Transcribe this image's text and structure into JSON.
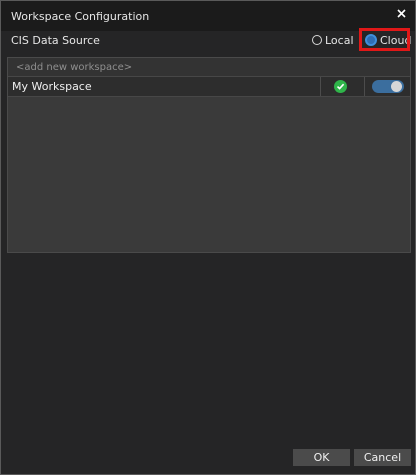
{
  "dialog": {
    "title": "Workspace Configuration"
  },
  "source": {
    "label": "CIS Data Source",
    "options": [
      {
        "label": "Local",
        "selected": false
      },
      {
        "label": "Cloud",
        "selected": true
      }
    ]
  },
  "workspaces": {
    "new_placeholder": "<add new workspace>",
    "rows": [
      {
        "name": "My Workspace",
        "status": "check-icon",
        "enabled": true
      }
    ]
  },
  "buttons": {
    "ok": "OK",
    "cancel": "Cancel"
  },
  "colors": {
    "highlight": "#e01818",
    "selected_radio": "#2f6eb5",
    "status_ok": "#2fb54a",
    "toggle_on": "#3b6e9e"
  }
}
